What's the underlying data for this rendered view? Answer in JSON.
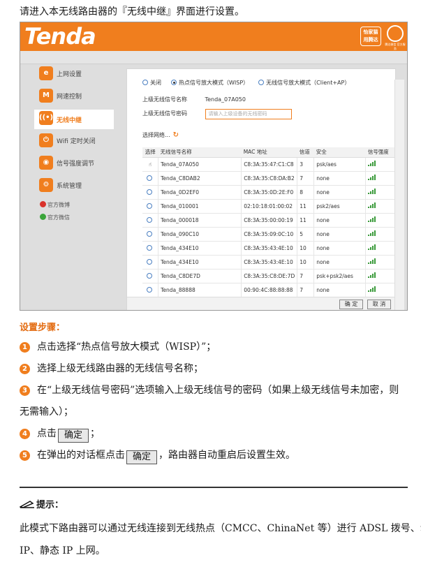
{
  "intro": "请进入本无线路由器的『无线中继』界面进行设置。",
  "router": {
    "logo": "Tenda",
    "badge": [
      "怡家猫",
      "用腾达"
    ],
    "badge_circle_caption": "腾达微信 官方服务",
    "nav": [
      {
        "label": "上网设置",
        "icon": "e-icon",
        "glyph": "e"
      },
      {
        "label": "网速控制",
        "icon": "speed-icon",
        "glyph": "M"
      },
      {
        "label": "无线中继",
        "icon": "wifi-repeat-icon",
        "glyph": "((•))",
        "active": true
      },
      {
        "label": "Wifi 定时关闭",
        "icon": "wifi-timer-icon",
        "glyph": "⏻"
      },
      {
        "label": "信号强度调节",
        "icon": "signal-strength-icon",
        "glyph": "◉"
      },
      {
        "label": "系统管理",
        "icon": "gear-icon",
        "glyph": "⚙"
      }
    ],
    "social": [
      {
        "label": "官方微博",
        "color": "#d9322b"
      },
      {
        "label": "官方微信",
        "color": "#3aa53a"
      }
    ],
    "modes": [
      "关闭",
      "热点信号放大模式（WISP）",
      "无线信号放大模式（Client+AP）"
    ],
    "selected_mode": 1,
    "ssid_label": "上级无线信号名称",
    "ssid_value": "Tenda_07A050",
    "password_label": "上级无线信号密码",
    "password_placeholder": "请输入上级设备的无线密码",
    "scan_label": "选择网络...",
    "columns": [
      "选择",
      "无线信号名称",
      "MAC 地址",
      "信道",
      "安全",
      "信号强度"
    ],
    "rows": [
      {
        "ssid": "Tenda_07A050",
        "mac": "C8:3A:35:47:C1:C8",
        "channel": "3",
        "security": "psk/aes",
        "selected": true
      },
      {
        "ssid": "Tenda_C8DAB2",
        "mac": "C8:3A:35:C8:DA:B2",
        "channel": "7",
        "security": "none"
      },
      {
        "ssid": "Tenda_0D2EF0",
        "mac": "C8:3A:35:0D:2E:F0",
        "channel": "8",
        "security": "none"
      },
      {
        "ssid": "Tenda_010001",
        "mac": "02:10:18:01:00:02",
        "channel": "11",
        "security": "psk2/aes"
      },
      {
        "ssid": "Tenda_000018",
        "mac": "C8:3A:35:00:00:19",
        "channel": "11",
        "security": "none"
      },
      {
        "ssid": "Tenda_090C10",
        "mac": "C8:3A:35:09:0C:10",
        "channel": "5",
        "security": "none"
      },
      {
        "ssid": "Tenda_434E10",
        "mac": "C8:3A:35:43:4E:10",
        "channel": "10",
        "security": "none"
      },
      {
        "ssid": "Tenda_434E10",
        "mac": "C8:3A:35:43:4E:10",
        "channel": "10",
        "security": "none"
      },
      {
        "ssid": "Tenda_C8DE7D",
        "mac": "C8:3A:35:C8:DE:7D",
        "channel": "7",
        "security": "psk+psk2/aes"
      },
      {
        "ssid": "Tenda_88888",
        "mac": "00:90:4C:88:88:88",
        "channel": "7",
        "security": "none"
      }
    ],
    "ok_label": "确 定",
    "cancel_label": "取 消"
  },
  "steps_title": "设置步骤：",
  "steps": [
    {
      "num": "1",
      "text": "点击选择“热点信号放大模式（WISP）”；"
    },
    {
      "num": "2",
      "text": "选择上级无线路由器的无线信号名称；"
    },
    {
      "num": "3",
      "text": "在“上级无线信号密码”选项输入上级无线信号的密码（如果上级无线信号未加密，则",
      "cont": "无需输入）；"
    },
    {
      "num": "4",
      "pre": "点击",
      "button": "确定",
      "post": "；"
    },
    {
      "num": "5",
      "pre": "在弹出的对话框点击",
      "button": "确定",
      "post": "，路由器自动重启后设置生效。"
    }
  ],
  "tip_title": "提示：",
  "tip_lines": [
    "此模式下路由器可以通过无线连接到无线热点（CMCC、ChinaNet 等）进行 ADSL 拨号、动态",
    "IP、静态 IP 上网。"
  ]
}
